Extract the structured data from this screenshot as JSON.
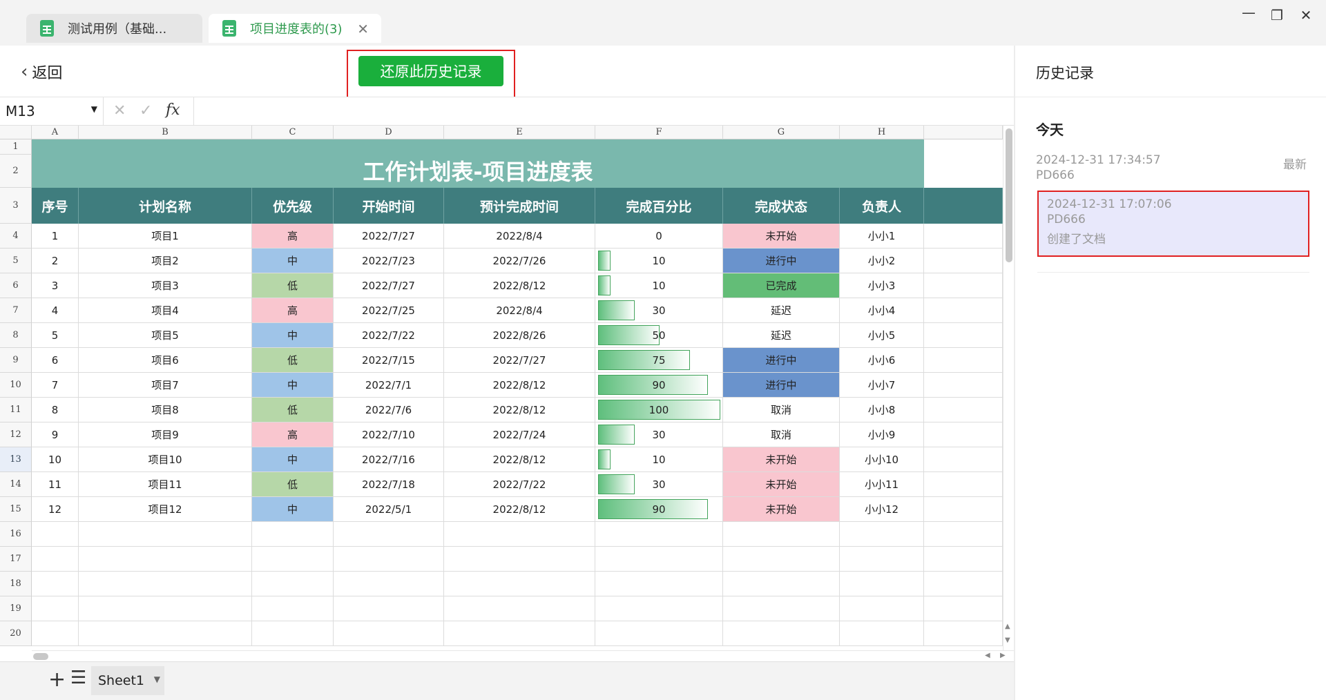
{
  "tabs": [
    {
      "label": "测试用例（基础...",
      "active": false
    },
    {
      "label": "项目进度表的(3)",
      "active": true
    }
  ],
  "window": {
    "minimize": "—",
    "restore": "❐",
    "close": "✕"
  },
  "toolbar": {
    "back_label": "返回",
    "restore_label": "还原此历史记录"
  },
  "formula": {
    "name_box": "M13",
    "fx": "fx",
    "cancel": "✕",
    "confirm": "✓"
  },
  "columns": [
    "A",
    "B",
    "C",
    "D",
    "E",
    "F",
    "G",
    "H"
  ],
  "rows": [
    "1",
    "2",
    "3",
    "4",
    "5",
    "6",
    "7",
    "8",
    "9",
    "10",
    "11",
    "12",
    "13",
    "14",
    "15",
    "16",
    "17",
    "18",
    "19",
    "20"
  ],
  "sheet": {
    "title": "工作计划表-项目进度表",
    "headers": [
      "序号",
      "计划名称",
      "优先级",
      "开始时间",
      "预计完成时间",
      "完成百分比",
      "完成状态",
      "负责人"
    ],
    "records": [
      {
        "no": "1",
        "name": "项目1",
        "priority": "高",
        "start": "2022/7/27",
        "end": "2022/8/4",
        "pct": "0",
        "status": "未开始",
        "owner": "小小1"
      },
      {
        "no": "2",
        "name": "项目2",
        "priority": "中",
        "start": "2022/7/23",
        "end": "2022/7/26",
        "pct": "10",
        "status": "进行中",
        "owner": "小小2"
      },
      {
        "no": "3",
        "name": "项目3",
        "priority": "低",
        "start": "2022/7/27",
        "end": "2022/8/12",
        "pct": "10",
        "status": "已完成",
        "owner": "小小3"
      },
      {
        "no": "4",
        "name": "项目4",
        "priority": "高",
        "start": "2022/7/25",
        "end": "2022/8/4",
        "pct": "30",
        "status": "延迟",
        "owner": "小小4"
      },
      {
        "no": "5",
        "name": "项目5",
        "priority": "中",
        "start": "2022/7/22",
        "end": "2022/8/26",
        "pct": "50",
        "status": "延迟",
        "owner": "小小5"
      },
      {
        "no": "6",
        "name": "项目6",
        "priority": "低",
        "start": "2022/7/15",
        "end": "2022/7/27",
        "pct": "75",
        "status": "进行中",
        "owner": "小小6"
      },
      {
        "no": "7",
        "name": "项目7",
        "priority": "中",
        "start": "2022/7/1",
        "end": "2022/8/12",
        "pct": "90",
        "status": "进行中",
        "owner": "小小7"
      },
      {
        "no": "8",
        "name": "项目8",
        "priority": "低",
        "start": "2022/7/6",
        "end": "2022/8/12",
        "pct": "100",
        "status": "取消",
        "owner": "小小8"
      },
      {
        "no": "9",
        "name": "项目9",
        "priority": "高",
        "start": "2022/7/10",
        "end": "2022/7/24",
        "pct": "30",
        "status": "取消",
        "owner": "小小9"
      },
      {
        "no": "10",
        "name": "项目10",
        "priority": "中",
        "start": "2022/7/16",
        "end": "2022/8/12",
        "pct": "10",
        "status": "未开始",
        "owner": "小小10"
      },
      {
        "no": "11",
        "name": "项目11",
        "priority": "低",
        "start": "2022/7/18",
        "end": "2022/7/22",
        "pct": "30",
        "status": "未开始",
        "owner": "小小11"
      },
      {
        "no": "12",
        "name": "项目12",
        "priority": "中",
        "start": "2022/5/1",
        "end": "2022/8/12",
        "pct": "90",
        "status": "未开始",
        "owner": "小小12"
      }
    ],
    "selected_row": "13",
    "priority_colors": {
      "高": "#f9c6cf",
      "中": "#9fc4e8",
      "低": "#b6d7a8"
    },
    "status_colors": {
      "未开始": "#f9c6cf",
      "进行中": "#6a93cc",
      "已完成": "#63bd77"
    },
    "title_color": "#7ab8ad",
    "header_color": "#3f7d7e"
  },
  "sheet_tabs": {
    "add": "+",
    "list": "☰",
    "active": "Sheet1"
  },
  "history": {
    "title": "历史记录",
    "group": "今天",
    "items": [
      {
        "time": "2024-12-31 17:34:57",
        "user": "PD666",
        "badge": "最新",
        "note": ""
      },
      {
        "time": "2024-12-31 17:07:06",
        "user": "PD666",
        "badge": "",
        "note": "创建了文档"
      }
    ]
  },
  "accent": "#1aaf3c",
  "highlight_border": "#e02020"
}
